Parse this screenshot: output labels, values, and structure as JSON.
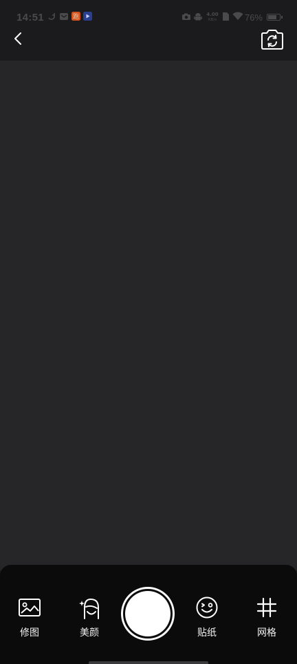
{
  "status_bar": {
    "time": "14:51",
    "battery": "76%"
  },
  "top_bar": {
    "back_icon": "chevron-left-icon",
    "switch_camera_icon": "camera-switch-icon"
  },
  "tools": [
    {
      "label": "修图",
      "icon": "image-edit-icon"
    },
    {
      "label": "美颜",
      "icon": "beauty-face-icon"
    },
    {
      "label": "贴纸",
      "icon": "sticker-smile-icon"
    },
    {
      "label": "网格",
      "icon": "grid-hash-icon"
    }
  ],
  "colors": {
    "viewfinder": "#262628",
    "panel": "#0b0b0c",
    "shutter": "#ffffff"
  }
}
